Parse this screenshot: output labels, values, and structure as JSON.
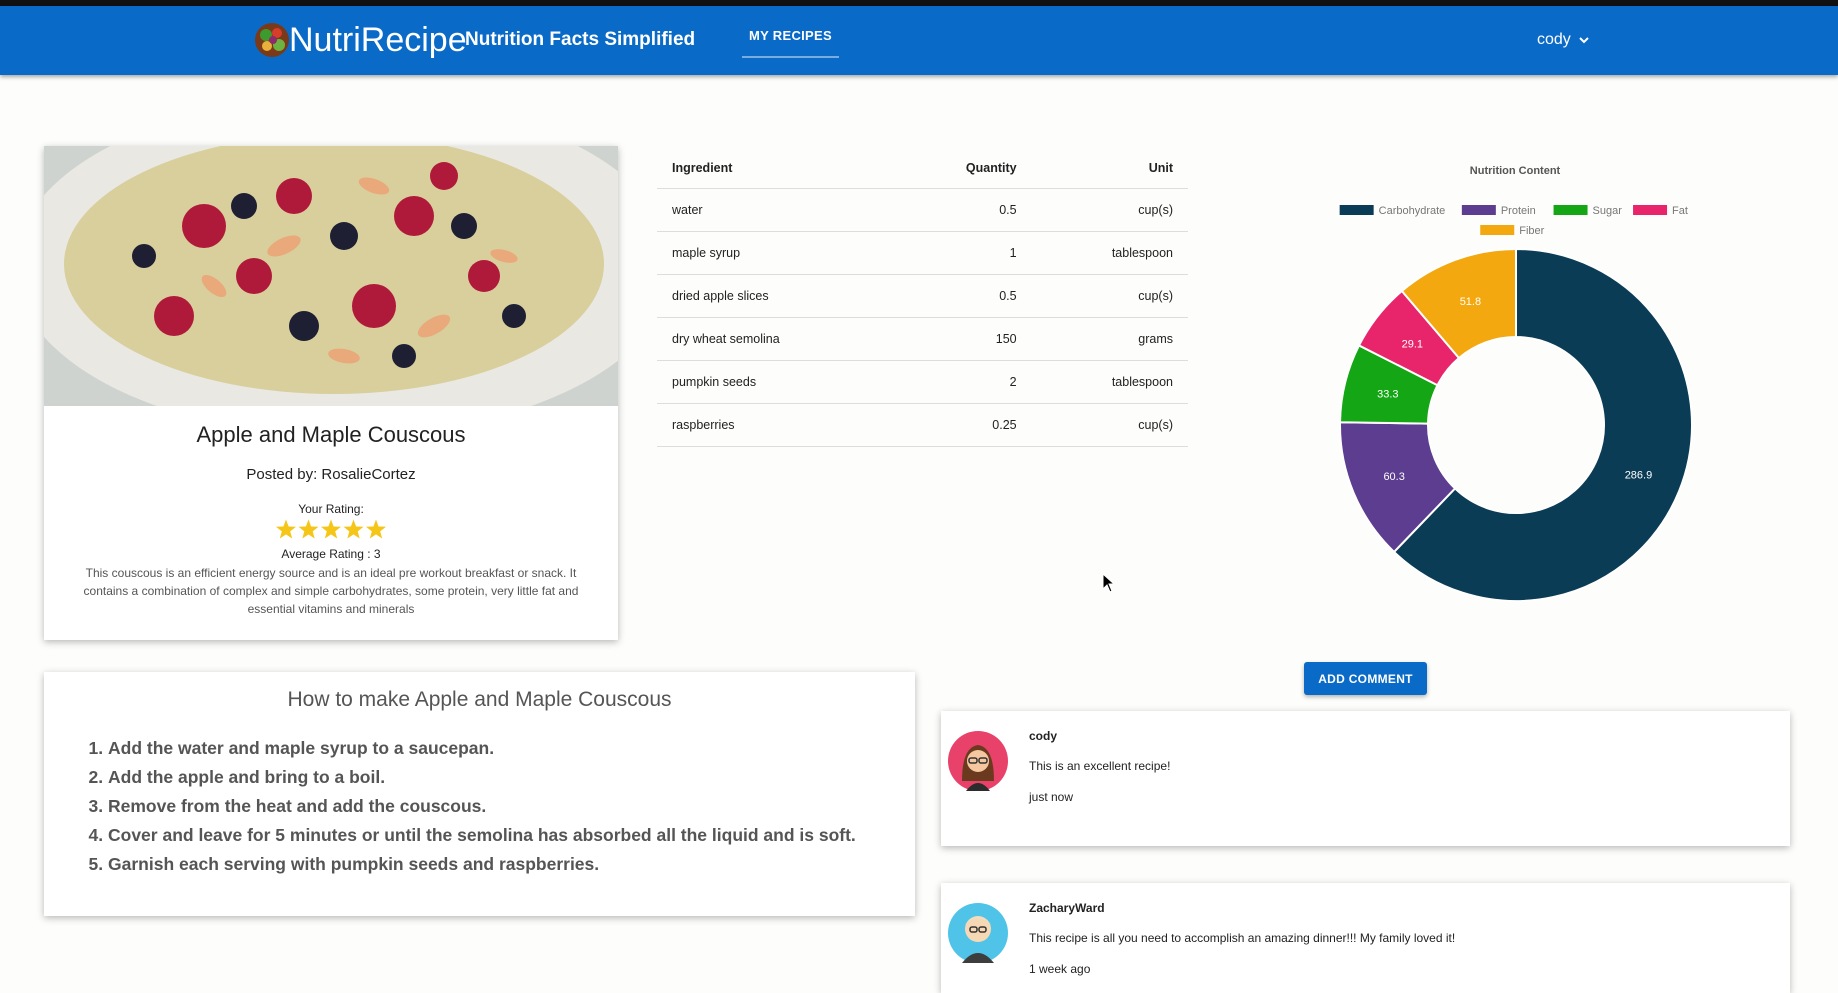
{
  "header": {
    "brand": "NutriRecipe",
    "tagline": "Nutrition Facts Simplified",
    "nav_tab": "MY RECIPES",
    "user": "cody",
    "user_icon": "chevron-down-icon",
    "color": "#0a6ac7"
  },
  "recipe": {
    "title": "Apple and Maple Couscous",
    "posted_by": "Posted by: RosalieCortez",
    "your_rating_label": "Your Rating:",
    "your_rating_stars": 5,
    "average_rating": "Average Rating : 3",
    "description": "This couscous is an efficient energy source and is an ideal pre workout breakfast or snack. It contains a combination of complex and simple carbohydrates, some protein, very little fat and essential vitamins and minerals"
  },
  "ingredients": {
    "headers": [
      "Ingredient",
      "Quantity",
      "Unit"
    ],
    "rows": [
      [
        "water",
        "0.5",
        "cup(s)"
      ],
      [
        "maple syrup",
        "1",
        "tablespoon"
      ],
      [
        "dried apple slices",
        "0.5",
        "cup(s)"
      ],
      [
        "dry wheat semolina",
        "150",
        "grams"
      ],
      [
        "pumpkin seeds",
        "2",
        "tablespoon"
      ],
      [
        "raspberries",
        "0.25",
        "cup(s)"
      ]
    ]
  },
  "chart_data": {
    "type": "pie",
    "title": "Nutrition Content",
    "categories": [
      "Carbohydrate",
      "Protein",
      "Sugar",
      "Fat",
      "Fiber"
    ],
    "values": [
      286.9,
      60.3,
      33.3,
      29.1,
      51.8
    ],
    "colors": [
      "#0b3c55",
      "#5c3d8f",
      "#14a614",
      "#e8256a",
      "#f2a80e"
    ],
    "legend_position": "top",
    "donut": true
  },
  "instructions": {
    "title": "How to make Apple and Maple Couscous",
    "steps": [
      "Add the water and maple syrup to a saucepan.",
      "Add the apple and bring to a boil.",
      "Remove from the heat and add the couscous.",
      "Cover and leave for 5 minutes or until the semolina has absorbed all the liquid and is soft.",
      "Garnish each serving with pumpkin seeds and raspberries."
    ]
  },
  "comments": {
    "add_label": "ADD COMMENT",
    "items": [
      {
        "user": "cody",
        "text": "This is an excellent recipe!",
        "time": "just now"
      },
      {
        "user": "ZacharyWard",
        "text": "This recipe is all you need to accomplish an amazing dinner!!! My family loved it!",
        "time": "1 week ago"
      }
    ]
  }
}
